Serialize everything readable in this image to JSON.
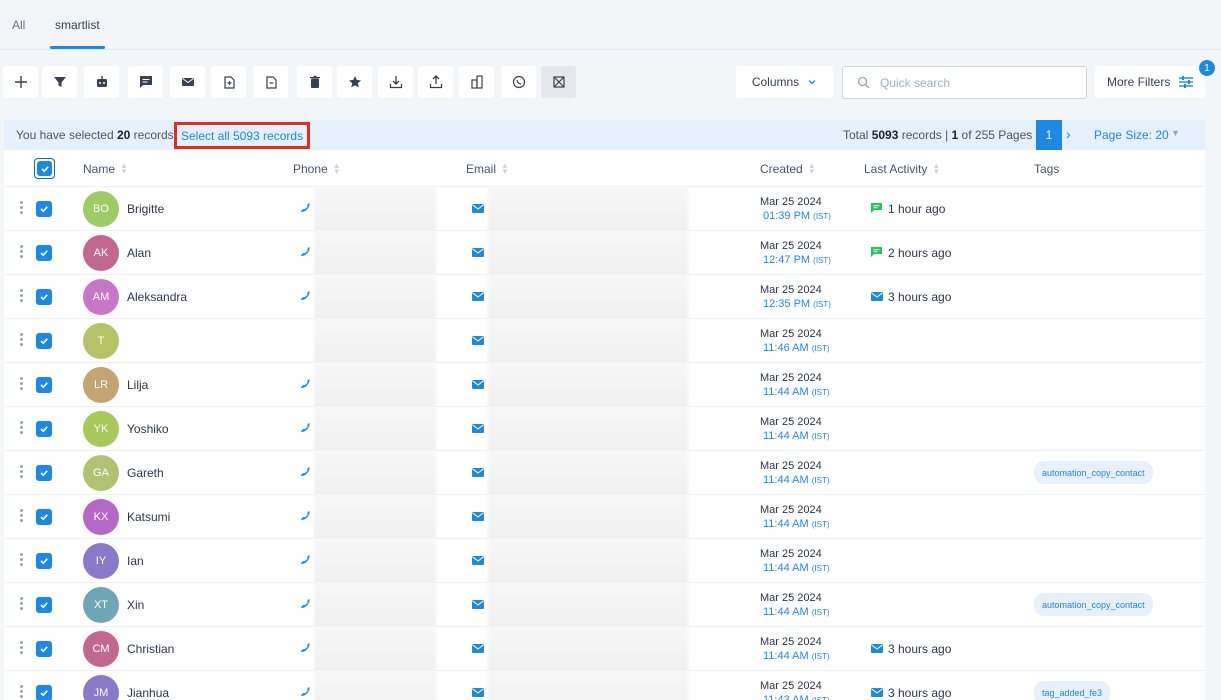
{
  "tabs": [
    {
      "label": "All"
    },
    {
      "label": "smartlist"
    }
  ],
  "toolbar": {
    "icons": [
      "add-icon",
      "filter-icon",
      "robot-icon",
      "message-icon",
      "mail-icon",
      "tag-add-icon",
      "tag-remove-icon",
      "delete-icon",
      "star-icon",
      "import-icon",
      "export-icon",
      "building-icon",
      "whatsapp-icon",
      "merge-icon"
    ],
    "columns_label": "Columns",
    "search_placeholder": "Quick search",
    "more_filters_label": "More Filters",
    "filter_count": "1"
  },
  "selection": {
    "prefix": "You have selected ",
    "count": "20",
    "suffix": " records.",
    "select_all_label": "Select all 5093 records",
    "total_prefix": "Total ",
    "total_count": "5093",
    "total_mid": " records | ",
    "page_current": "1",
    "total_suffix": " of 255 Pages",
    "page_button": "1",
    "page_size": "Page Size: 20"
  },
  "table": {
    "headers": {
      "name": "Name",
      "phone": "Phone",
      "email": "Email",
      "created": "Created",
      "last_activity": "Last Activity",
      "tags": "Tags"
    },
    "rows": [
      {
        "initials": "BO",
        "name": "Brigitte",
        "color": "#9ccc65",
        "phone": true,
        "date": "Mar 25 2024",
        "time": "01:39 PM",
        "tz": "(IST)",
        "activity": "1 hour ago",
        "activity_icon": "sms",
        "tag": ""
      },
      {
        "initials": "AK",
        "name": "Alan",
        "color": "#c2678f",
        "phone": true,
        "date": "Mar 25 2024",
        "time": "12:47 PM",
        "tz": "(IST)",
        "activity": "2 hours ago",
        "activity_icon": "sms",
        "tag": ""
      },
      {
        "initials": "AM",
        "name": "Aleksandra",
        "color": "#c777c5",
        "phone": true,
        "date": "Mar 25 2024",
        "time": "12:35 PM",
        "tz": "(IST)",
        "activity": "3 hours ago",
        "activity_icon": "email",
        "tag": ""
      },
      {
        "initials": "T",
        "name": "",
        "color": "#b5c266",
        "phone": false,
        "date": "Mar 25 2024",
        "time": "11:46 AM",
        "tz": "(IST)",
        "activity": "",
        "activity_icon": "",
        "tag": ""
      },
      {
        "initials": "LR",
        "name": "Lilja",
        "color": "#c4a470",
        "phone": true,
        "date": "Mar 25 2024",
        "time": "11:44 AM",
        "tz": "(IST)",
        "activity": "",
        "activity_icon": "",
        "tag": ""
      },
      {
        "initials": "YK",
        "name": "Yoshiko",
        "color": "#a8c85a",
        "phone": true,
        "date": "Mar 25 2024",
        "time": "11:44 AM",
        "tz": "(IST)",
        "activity": "",
        "activity_icon": "",
        "tag": ""
      },
      {
        "initials": "GA",
        "name": "Gareth",
        "color": "#b3c172",
        "phone": true,
        "date": "Mar 25 2024",
        "time": "11:44 AM",
        "tz": "(IST)",
        "activity": "",
        "activity_icon": "",
        "tag": "automation_copy_contact"
      },
      {
        "initials": "KX",
        "name": "Katsumi",
        "color": "#b668c8",
        "phone": true,
        "date": "Mar 25 2024",
        "time": "11:44 AM",
        "tz": "(IST)",
        "activity": "",
        "activity_icon": "",
        "tag": ""
      },
      {
        "initials": "IY",
        "name": "Ian",
        "color": "#8a78c8",
        "phone": true,
        "date": "Mar 25 2024",
        "time": "11:44 AM",
        "tz": "(IST)",
        "activity": "",
        "activity_icon": "",
        "tag": ""
      },
      {
        "initials": "XT",
        "name": "Xin",
        "color": "#6ea6b8",
        "phone": true,
        "date": "Mar 25 2024",
        "time": "11:44 AM",
        "tz": "(IST)",
        "activity": "",
        "activity_icon": "",
        "tag": "automation_copy_contact"
      },
      {
        "initials": "CM",
        "name": "Christian",
        "color": "#c2678f",
        "phone": true,
        "date": "Mar 25 2024",
        "time": "11:44 AM",
        "tz": "(IST)",
        "activity": "3 hours ago",
        "activity_icon": "email",
        "tag": ""
      },
      {
        "initials": "JM",
        "name": "Jianhua",
        "color": "#8a78c8",
        "phone": true,
        "date": "Mar 25 2024",
        "time": "11:43 AM",
        "tz": "(IST)",
        "activity": "3 hours ago",
        "activity_icon": "email",
        "tag": "tag_added_fe3"
      }
    ]
  },
  "colors": {
    "accent": "#1e88e5",
    "highlight_box": "#e02d1f",
    "sms_green": "#22c55e"
  }
}
